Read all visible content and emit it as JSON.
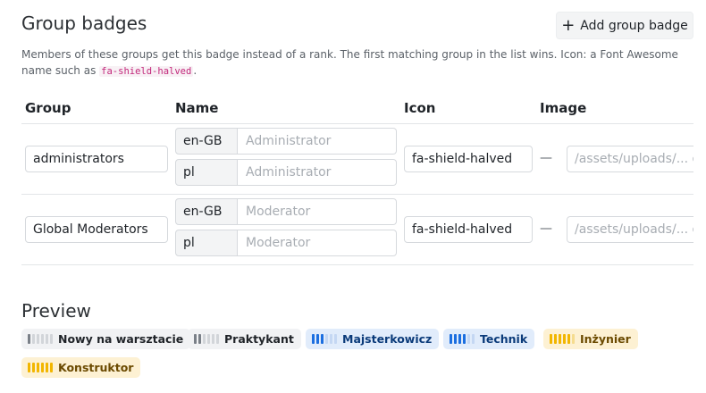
{
  "header": {
    "title": "Group badges",
    "add_button_label": "Add group badge",
    "add_button_icon": "plus-icon"
  },
  "description": {
    "text": "Members of these groups get this badge instead of a rank. The first matching group in the list wins. Icon: a Font Awesome name such as",
    "code": "fa-shield-halved",
    "suffix": "."
  },
  "table": {
    "columns": [
      "Group",
      "Name",
      "Icon",
      "Image"
    ],
    "rows": [
      {
        "group": "administrators",
        "names": [
          {
            "lang": "en-GB",
            "placeholder": "Administrator"
          },
          {
            "lang": "pl",
            "placeholder": "Administrator"
          }
        ],
        "icon": "fa-shield-halved",
        "separator": "—",
        "image_placeholder": "/assets/uploads/... or"
      },
      {
        "group": "Global Moderators",
        "names": [
          {
            "lang": "en-GB",
            "placeholder": "Moderator"
          },
          {
            "lang": "pl",
            "placeholder": "Moderator"
          }
        ],
        "icon": "fa-shield-halved",
        "separator": "—",
        "image_placeholder": "/assets/uploads/... or"
      }
    ]
  },
  "preview": {
    "title": "Preview",
    "badges": [
      {
        "label": "Nowy na warsztacie",
        "level": 1,
        "bg": "#f1f2f4",
        "fg": "#1f2328",
        "on": "#7a8088",
        "off": "#d2d5d9"
      },
      {
        "label": "Praktykant",
        "level": 2,
        "bg": "#f1f2f4",
        "fg": "#1f2328",
        "on": "#7a8088",
        "off": "#d2d5d9"
      },
      {
        "label": "Majsterkowicz",
        "level": 3,
        "bg": "#e1ecfb",
        "fg": "#0b3b7a",
        "on": "#1c6fe0",
        "off": "#c4d7f3"
      },
      {
        "label": "Technik",
        "level": 4,
        "bg": "#e1ecfb",
        "fg": "#0b3b7a",
        "on": "#1c6fe0",
        "off": "#c4d7f3"
      },
      {
        "label": "Inżynier",
        "level": 5,
        "bg": "#fdf1d3",
        "fg": "#6b4a00",
        "on": "#f2b600",
        "off": "#f5dc8f"
      },
      {
        "label": "Konstruktor",
        "level": 6,
        "bg": "#fdf1d3",
        "fg": "#6b4a00",
        "on": "#f2b600",
        "off": "#f5dc8f"
      }
    ],
    "total_bars": 6
  }
}
